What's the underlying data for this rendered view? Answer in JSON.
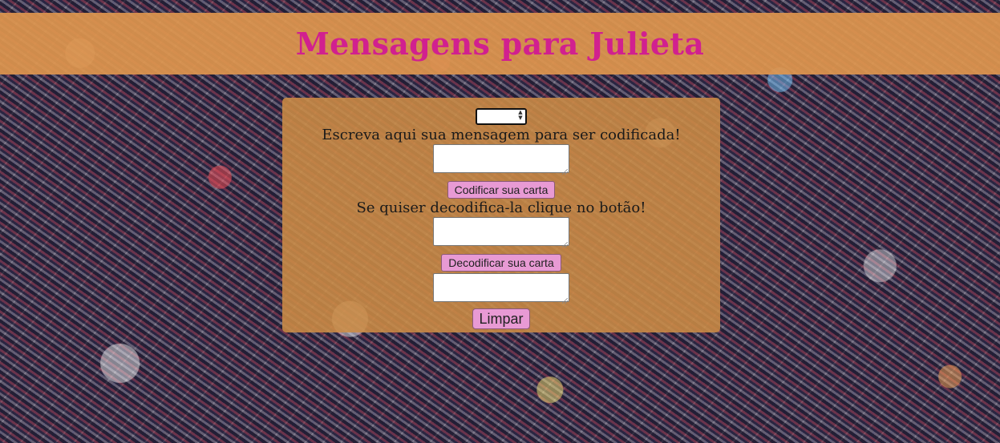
{
  "header": {
    "title": "Mensagens para Julieta"
  },
  "form": {
    "shift_value": "",
    "encode_instruction": "Escreva aqui sua mensagem para ser codificada!",
    "encode_input_value": "",
    "encode_button_label": "Codificar sua carta",
    "decode_instruction": "Se quiser decodifica-la clique no botão!",
    "decode_input_value": "",
    "decode_button_label": "Decodificar sua carta",
    "output_value": "",
    "clear_button_label": "Limpar"
  },
  "colors": {
    "header_bg": "#de964e",
    "title_color": "#d1208f",
    "panel_bg": "#cc8c46",
    "button_bg": "#e89ad4"
  }
}
